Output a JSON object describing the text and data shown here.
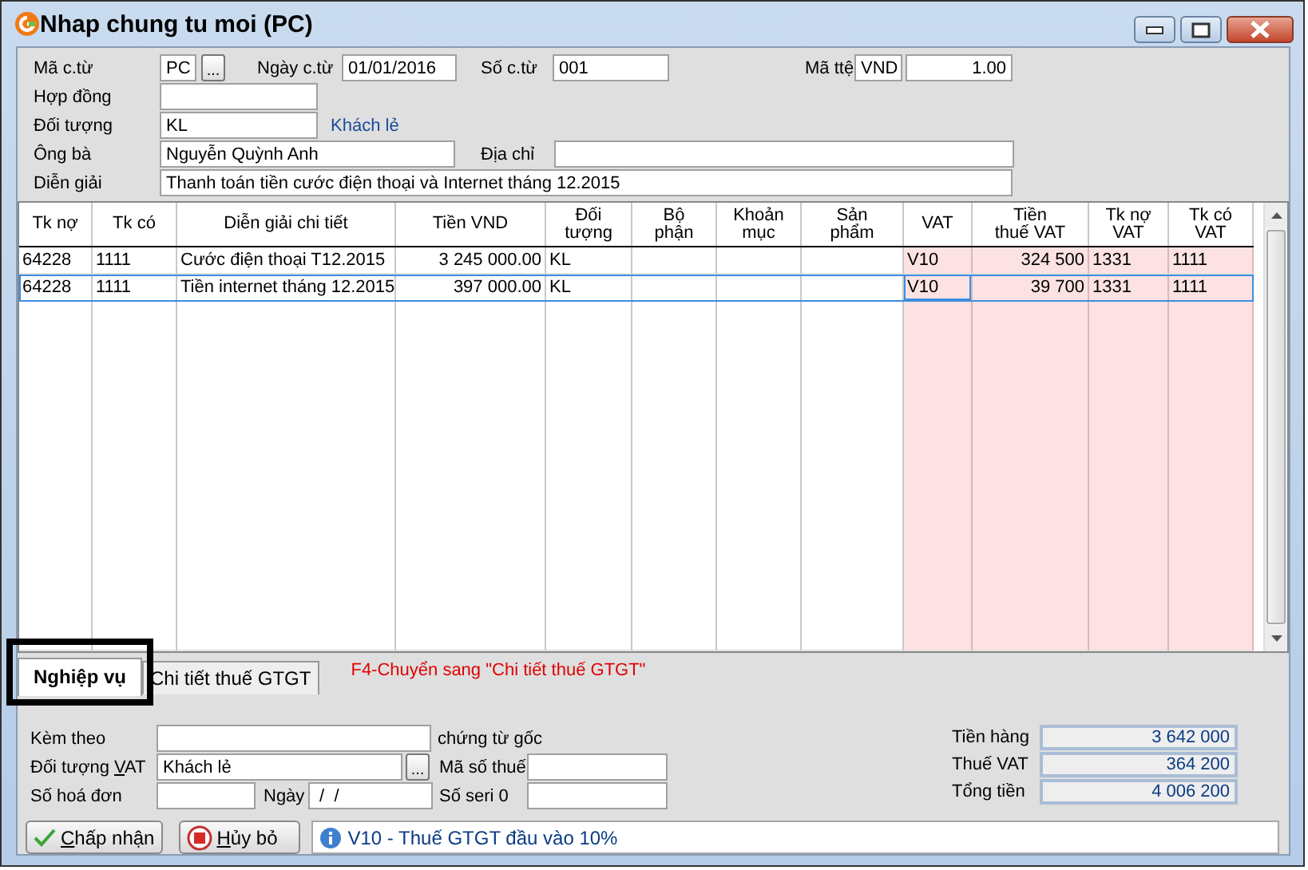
{
  "window": {
    "title": "Nhap chung tu moi (PC)"
  },
  "header": {
    "ma_ctu": {
      "label": "Mã c.từ",
      "value": "PC",
      "button": "..."
    },
    "ngay_ctu": {
      "label": "Ngày c.từ",
      "value": "01/01/2016"
    },
    "so_ctu": {
      "label": "Số c.từ",
      "value": "001"
    },
    "ma_te": {
      "label": "Mã ttệ",
      "value": "VND",
      "rate": "1.00"
    },
    "hop_dong": {
      "label": "Hợp đồng"
    },
    "doi_tuong": {
      "label": "Đối tượng",
      "value": "KL",
      "name": "Khách lẻ"
    },
    "ong_ba": {
      "label": "Ông bà",
      "value": "Nguyễn Quỳnh Anh"
    },
    "dia_chi": {
      "label": "Địa chỉ"
    },
    "dien_giai": {
      "label": "Diễn giải",
      "value": "Thanh toán tiền cước điện thoại và Internet tháng 12.2015"
    }
  },
  "table": {
    "columns": [
      {
        "label": "Tk nợ",
        "tinted": false
      },
      {
        "label": "Tk có",
        "tinted": false
      },
      {
        "label": "Diễn giải chi tiết",
        "tinted": false
      },
      {
        "label": "Tiền VND",
        "tinted": false
      },
      {
        "label": "Đối\ntượng",
        "tinted": false
      },
      {
        "label": "Bộ\nphận",
        "tinted": false
      },
      {
        "label": "Khoản\nmục",
        "tinted": false
      },
      {
        "label": "Sản\nphẩm",
        "tinted": false
      },
      {
        "label": "VAT",
        "tinted": true
      },
      {
        "label": "Tiền\nthuế VAT",
        "tinted": true
      },
      {
        "label": "Tk nợ\nVAT",
        "tinted": true
      },
      {
        "label": "Tk có\nVAT",
        "tinted": true
      }
    ],
    "rows": [
      {
        "tk_no": "64228",
        "tk_co": "1111",
        "dien_giai": "Cước điện thoại T12.2015",
        "tien_vnd": "3 245 000.00",
        "doi_tuong": "KL",
        "vat": "V10",
        "tien_thue_vat": "324 500",
        "tk_no_vat": "1331",
        "tk_co_vat": "1111",
        "selected": false,
        "editing_vat": false
      },
      {
        "tk_no": "64228",
        "tk_co": "1111",
        "dien_giai": "Tiền internet tháng 12.2015",
        "tien_vnd": "397 000.00",
        "doi_tuong": "KL",
        "vat": "V10",
        "tien_thue_vat": "39 700",
        "tk_no_vat": "1331",
        "tk_co_vat": "1111",
        "selected": true,
        "editing_vat": true
      }
    ]
  },
  "tabs": [
    {
      "label": "Nghiệp vụ",
      "selected": true
    },
    {
      "label": "Chi tiết thuế GTGT",
      "selected": false
    }
  ],
  "hint": "F4-Chuyển sang \"Chi tiết thuế GTGT\"",
  "details": {
    "kem_theo": {
      "label": "Kèm theo",
      "suffix": "chứng từ gốc"
    },
    "doi_tuong_vat": {
      "label_parts": [
        "Đối tượng ",
        "V",
        "AT"
      ],
      "value": "Khách lẻ",
      "button": "..."
    },
    "ma_so_thue": {
      "label": "Mã số thuế"
    },
    "so_hoa_don": {
      "label": "Số hoá đơn"
    },
    "ngay": {
      "label": "Ngày",
      "value": " /  /"
    },
    "so_seri": {
      "label": "Số seri 0"
    }
  },
  "totals": [
    {
      "label": "Tiền hàng",
      "value": "3 642 000"
    },
    {
      "label": "Thuế VAT",
      "value": "364 200"
    },
    {
      "label": "Tổng tiền",
      "value": "4 006 200"
    }
  ],
  "buttons": [
    {
      "kind": "accept",
      "accel": "C",
      "label_rest": "hấp nhận"
    },
    {
      "kind": "cancel",
      "accel": "H",
      "label_rest": "ủy bỏ"
    }
  ],
  "status": "V10 - Thuế GTGT đầu vào 10%"
}
